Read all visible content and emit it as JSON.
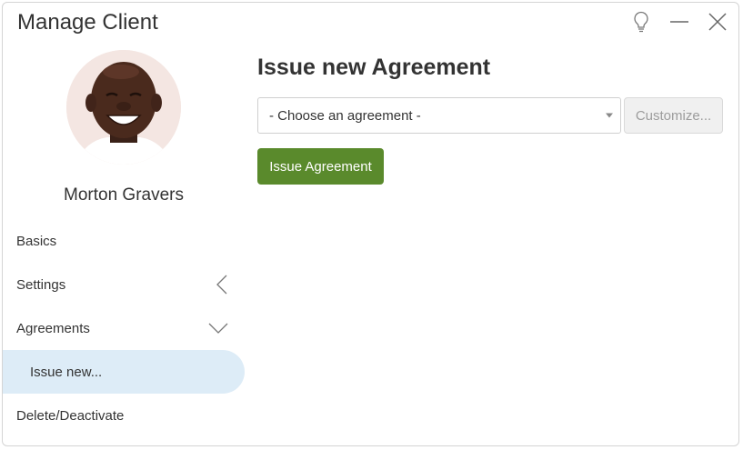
{
  "window": {
    "title": "Manage Client",
    "controls": [
      {
        "name": "lightbulb-icon"
      },
      {
        "name": "minimize-icon"
      },
      {
        "name": "close-icon"
      }
    ]
  },
  "client": {
    "name": "Morton Gravers",
    "avatar_icon": "avatar-photo"
  },
  "sidebar": {
    "items": [
      {
        "label": "Basics"
      },
      {
        "label": "Settings",
        "icon": "chevron-left-icon"
      },
      {
        "label": "Agreements",
        "icon": "chevron-down-icon"
      },
      {
        "label": "Issue new...",
        "selected": true
      },
      {
        "label": "Delete/Deactivate"
      }
    ]
  },
  "main": {
    "title": "Issue new Agreement",
    "agreement_select": {
      "value": "- Choose an agreement -"
    },
    "customize_label": "Customize...",
    "issue_label": "Issue Agreement"
  },
  "colors": {
    "accent_green": "#5a8a2c",
    "selected_bg": "#ddecf7",
    "disabled_bg": "#f0f0f0"
  }
}
